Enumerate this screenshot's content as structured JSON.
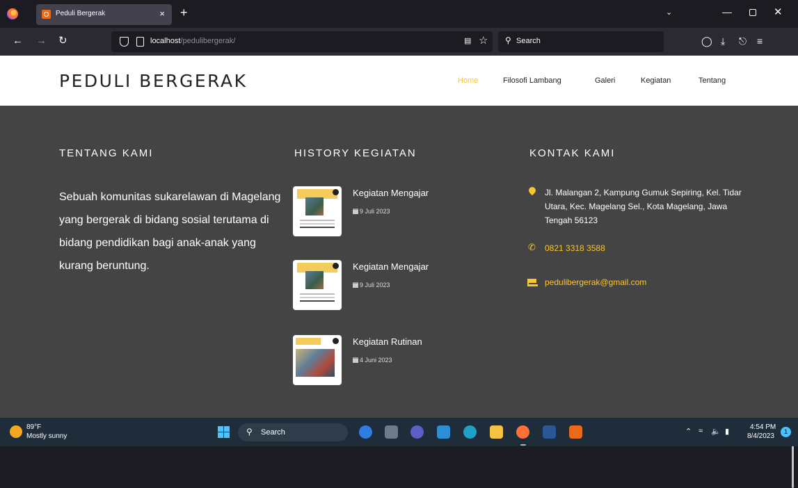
{
  "browser": {
    "tab_title": "Peduli Bergerak",
    "tab_close": "×",
    "new_tab": "+",
    "url_host": "localhost",
    "url_path": "/pedulibergerak/",
    "search_placeholder": "Search"
  },
  "site": {
    "brand": "PEDULI BERGERAK",
    "menu": [
      {
        "label": "Home",
        "active": true
      },
      {
        "label": "Filosofi Lambang",
        "active": false
      },
      {
        "label": "Galeri",
        "active": false
      },
      {
        "label": "Kegiatan",
        "active": false
      },
      {
        "label": "Tentang",
        "active": false
      }
    ]
  },
  "about": {
    "title": "TENTANG KAMI",
    "text": "Sebuah komunitas sukarelawan di Magelang yang bergerak di bidang sosial terutama di bidang pendidikan bagi anak-anak yang kurang beruntung."
  },
  "history": {
    "title": "HISTORY KEGIATAN",
    "items": [
      {
        "title": "Kegiatan Mengajar",
        "date": "9 Juli 2023"
      },
      {
        "title": "Kegiatan Mengajar",
        "date": "9 Juli 2023"
      },
      {
        "title": "Kegiatan Rutinan",
        "date": "4 Juni 2023"
      }
    ]
  },
  "contact": {
    "title": "KONTAK KAMI",
    "address": "Jl. Malangan 2, Kampung Gumuk Sepiring, Kel. Tidar Utara, Kec. Magelang Sel., Kota Magelang, Jawa Tengah 56123",
    "phone": "0821 3318 3588",
    "email": "pedulibergerak@gmail.com"
  },
  "colors": {
    "accent": "#fbc531",
    "footer_bg": "#444444",
    "header_bg": "#ffffff"
  },
  "taskbar": {
    "weather_temp": "89°F",
    "weather_desc": "Mostly sunny",
    "search_label": "Search",
    "time": "4:54 PM",
    "date": "8/4/2023",
    "notification_count": "1"
  }
}
